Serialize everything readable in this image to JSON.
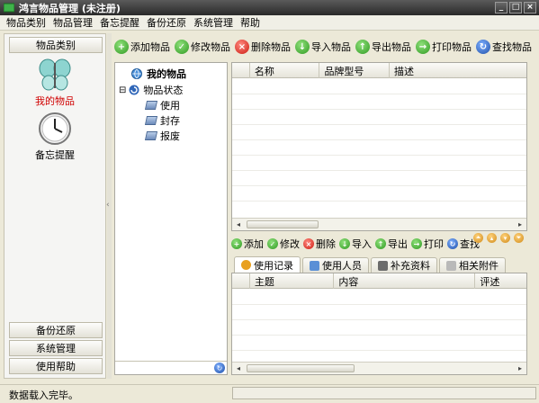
{
  "window": {
    "title": "鸿言物品管理  (未注册)",
    "min": "_",
    "max": "□",
    "close": "×"
  },
  "menu": [
    "物品类别",
    "物品管理",
    "备忘提醒",
    "备份还原",
    "系统管理",
    "帮助"
  ],
  "left": {
    "header": "物品类别",
    "items": [
      {
        "label": "我的物品",
        "icon": "butterfly-icon"
      },
      {
        "label": "备忘提醒",
        "icon": "clock-icon"
      }
    ],
    "bottom": [
      "备份还原",
      "系统管理",
      "使用帮助"
    ],
    "collapse": "‹"
  },
  "toolbar": [
    {
      "label": "添加物品",
      "glyph": "+",
      "color": "green"
    },
    {
      "label": "修改物品",
      "glyph": "✓",
      "color": "green"
    },
    {
      "label": "删除物品",
      "glyph": "×",
      "color": "red"
    },
    {
      "label": "导入物品",
      "glyph": "↓",
      "color": "green"
    },
    {
      "label": "导出物品",
      "glyph": "↑",
      "color": "green"
    },
    {
      "label": "打印物品",
      "glyph": "→",
      "color": "green"
    },
    {
      "label": "查找物品",
      "glyph": "↻",
      "color": "blue"
    }
  ],
  "tree": {
    "root": "我的物品",
    "group": "物品状态",
    "expander": "⊟",
    "children": [
      "使用",
      "封存",
      "报废"
    ]
  },
  "table_main": {
    "columns": [
      "名称",
      "品牌型号",
      "描述"
    ]
  },
  "toolbar2": [
    {
      "label": "添加",
      "glyph": "+",
      "color": "green"
    },
    {
      "label": "修改",
      "glyph": "✓",
      "color": "green"
    },
    {
      "label": "删除",
      "glyph": "×",
      "color": "red"
    },
    {
      "label": "导入",
      "glyph": "↓",
      "color": "green"
    },
    {
      "label": "导出",
      "glyph": "↑",
      "color": "green"
    },
    {
      "label": "打印",
      "glyph": "→",
      "color": "green"
    },
    {
      "label": "查找",
      "glyph": "↻",
      "color": "blue"
    }
  ],
  "tabs": [
    "使用记录",
    "使用人员",
    "补充资料",
    "相关附件"
  ],
  "table_sub": {
    "columns": [
      "主题",
      "内容",
      "评述"
    ]
  },
  "scroll": {
    "left": "◂",
    "right": "▸"
  },
  "status": "数据载入完毕。"
}
